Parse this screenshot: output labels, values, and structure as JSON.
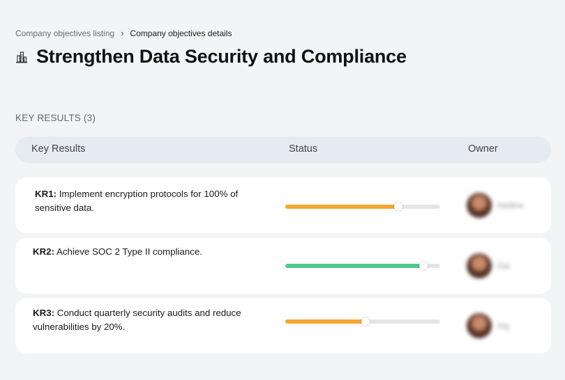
{
  "breadcrumb": {
    "parent": "Company objectives listing",
    "separator": "›",
    "current": "Company objectives details"
  },
  "header": {
    "icon": "building-icon",
    "title": "Strengthen Data Security and Compliance"
  },
  "section": {
    "label": "KEY RESULTS (3)"
  },
  "table": {
    "columns": {
      "key_results": "Key Results",
      "status": "Status",
      "owner": "Owner"
    }
  },
  "colors": {
    "orange": "#f7a531",
    "green": "#4ec98a"
  },
  "key_results": [
    {
      "id": "KR1:",
      "text": "Implement encryption protocols for 100% of sensitive data.",
      "progress": 0.73,
      "color": "#f7a531",
      "owner": "Nadine"
    },
    {
      "id": "KR2:",
      "text": "Achieve SOC 2 Type II compliance.",
      "progress": 0.89,
      "color": "#4ec98a",
      "owner": "Dal"
    },
    {
      "id": "KR3:",
      "text": "Conduct quarterly security audits and reduce vulnerabilities by 20%.",
      "progress": 0.52,
      "color": "#f7a531",
      "owner": "Ing"
    }
  ]
}
